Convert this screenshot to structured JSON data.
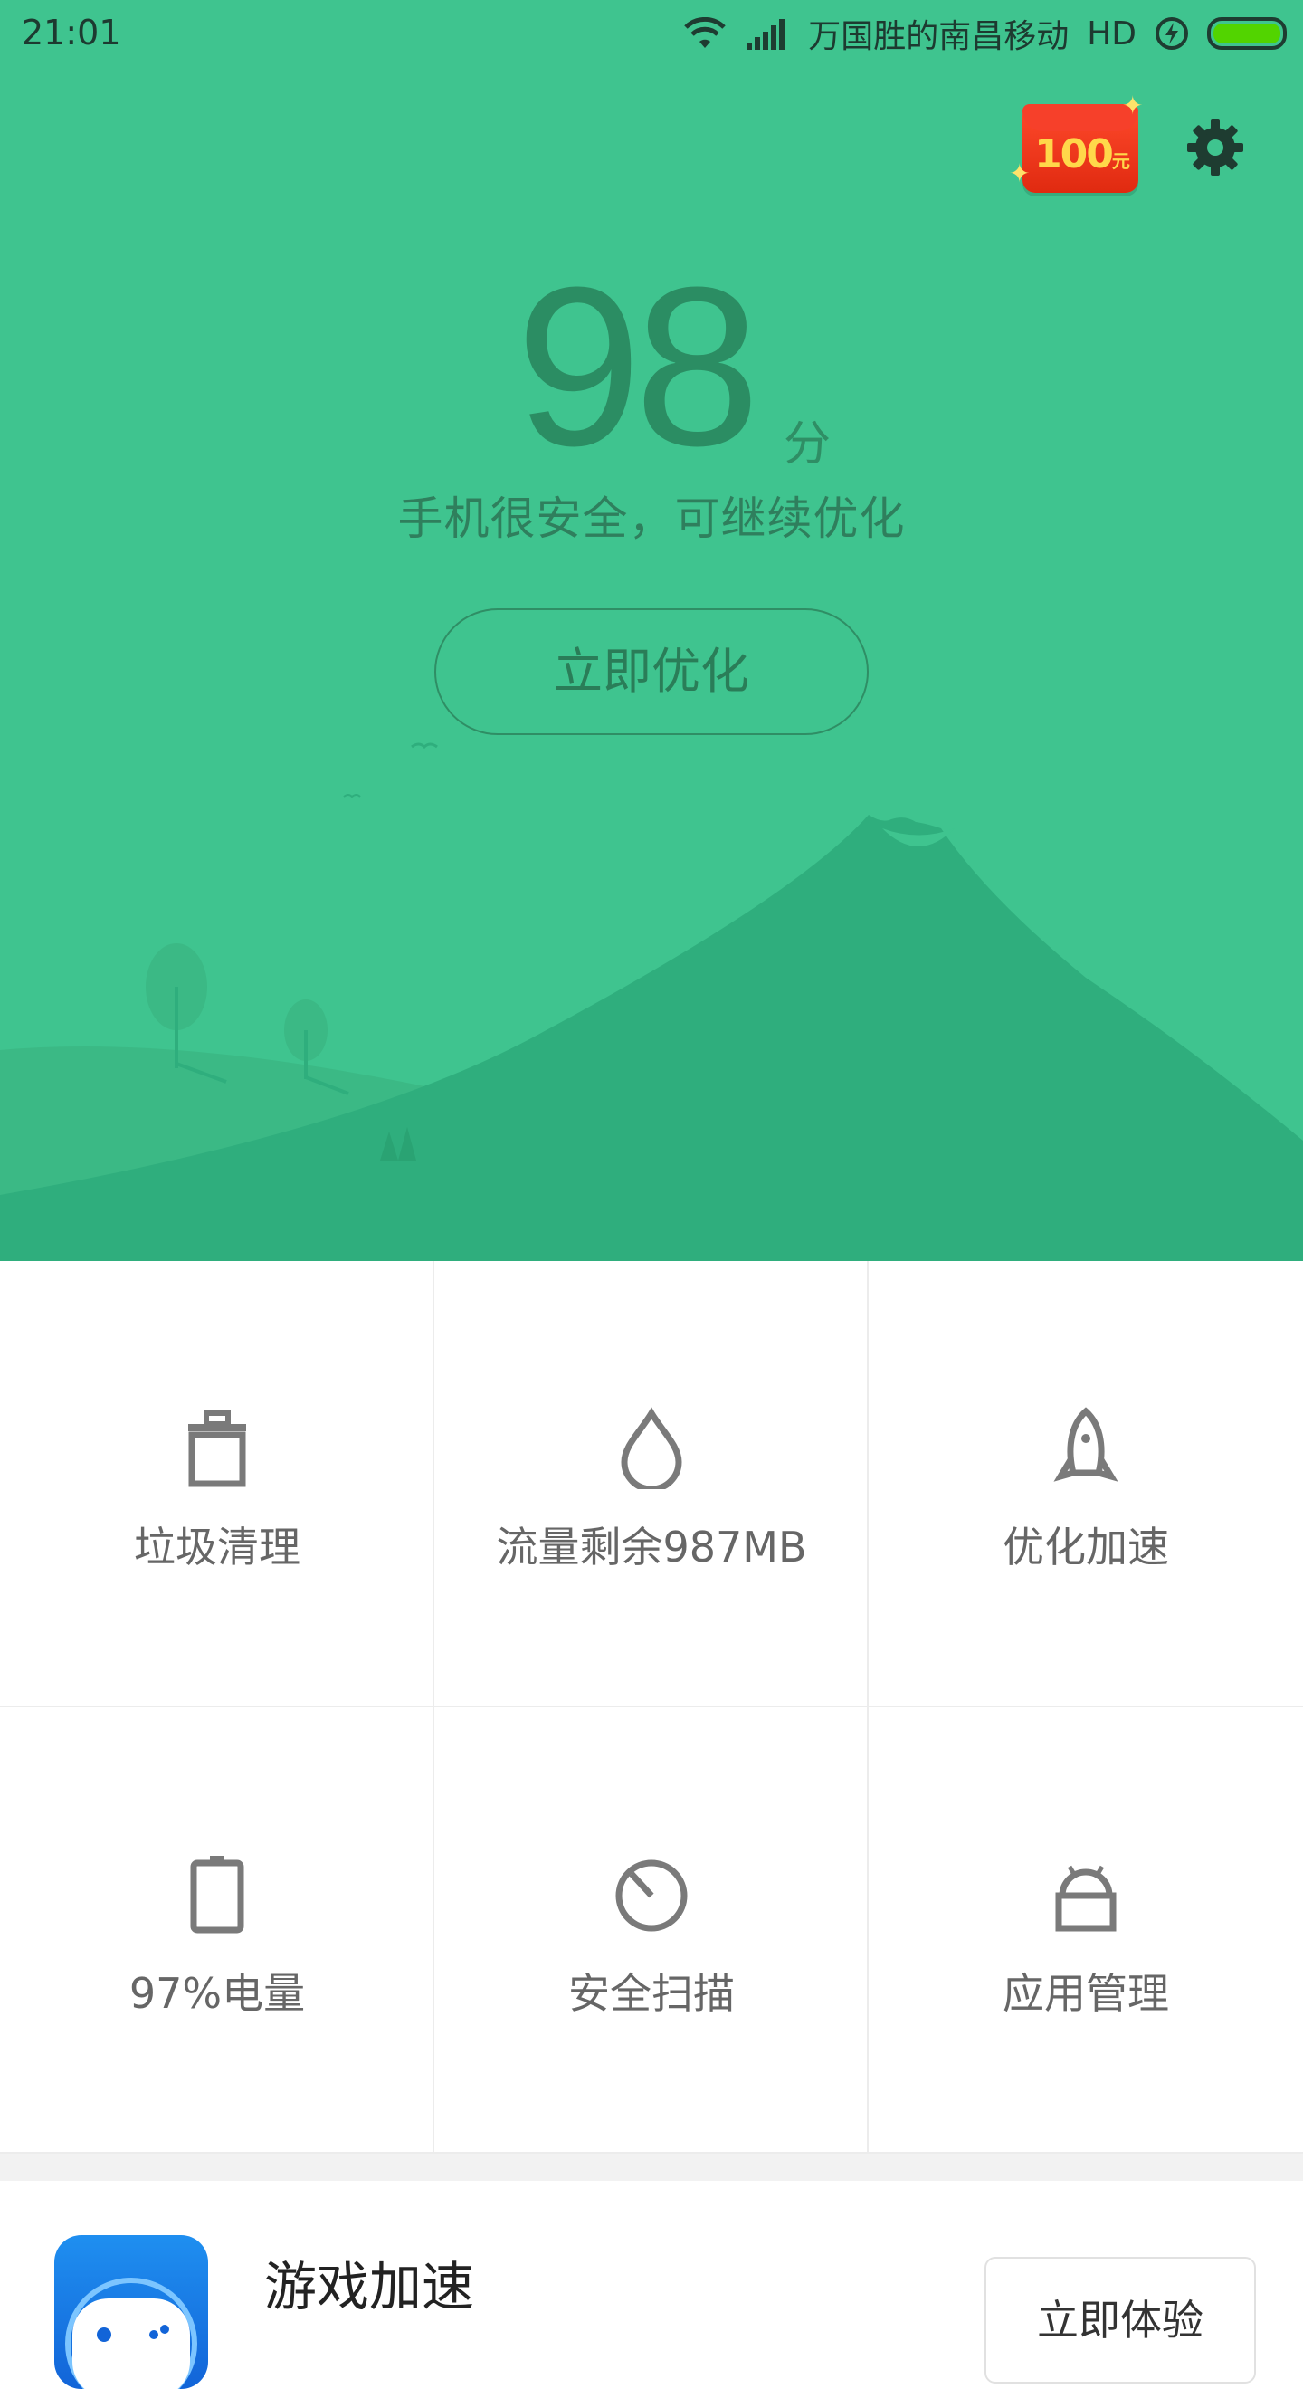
{
  "status_bar": {
    "time": "21:01",
    "carrier": "万国胜的南昌移动",
    "network": "HD"
  },
  "header": {
    "red_packet_amount": "100",
    "red_packet_unit": "元"
  },
  "score": {
    "value": "98",
    "unit": "分",
    "status_text": "手机很安全，可继续优化",
    "action_label": "立即优化"
  },
  "tiles": [
    {
      "label": "垃圾清理",
      "icon": "trash-icon"
    },
    {
      "label": "流量剩余987MB",
      "icon": "data-drop-icon"
    },
    {
      "label": "优化加速",
      "icon": "rocket-icon"
    },
    {
      "label": "97%电量",
      "icon": "battery-icon"
    },
    {
      "label": "安全扫描",
      "icon": "security-scan-icon"
    },
    {
      "label": "应用管理",
      "icon": "android-app-icon"
    }
  ],
  "promo": {
    "title": "游戏加速",
    "button_label": "立即体验",
    "icon": "gamepad-icon"
  },
  "colors": {
    "hero_bg": "#3fc48f",
    "mountain": "#2fae7d",
    "accent_text": "#2b8d63",
    "battery_fill": "#52d400"
  }
}
